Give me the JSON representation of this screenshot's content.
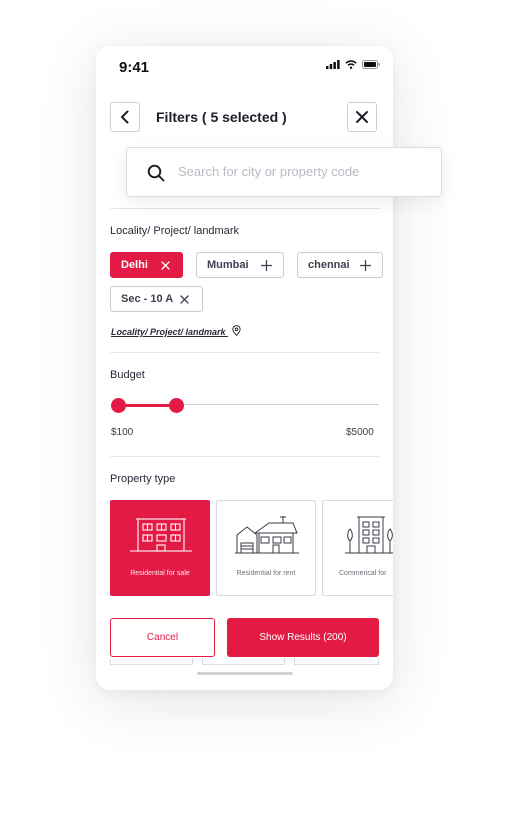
{
  "status_bar": {
    "time": "9:41"
  },
  "header": {
    "title": "Filters ( 5 selected )"
  },
  "search": {
    "placeholder": "Search for city or property code"
  },
  "locality": {
    "label": "Locality/ Project/ landmark",
    "chips": [
      {
        "label": "Delhi",
        "selected": true
      },
      {
        "label": "Mumbai",
        "selected": false
      },
      {
        "label": "chennai",
        "selected": false
      },
      {
        "label": "Sec - 10 A",
        "selected": true
      }
    ],
    "link_text": "Locality/ Project/ landmark"
  },
  "budget": {
    "label": "Budget",
    "min_label": "$100",
    "max_label": "$5000",
    "selected_range_fraction": [
      0.0,
      0.22
    ]
  },
  "property_type": {
    "label": "Property type",
    "options": [
      {
        "label": "Residential for sale",
        "selected": true,
        "icon": "apartment-building-icon"
      },
      {
        "label": "Residential for rent",
        "selected": false,
        "icon": "house-icon"
      },
      {
        "label": "Commerical for",
        "selected": false,
        "icon": "commercial-building-icon"
      }
    ]
  },
  "actions": {
    "cancel_label": "Cancel",
    "show_results_label": "Show Results (200)"
  },
  "colors": {
    "accent": "#e31b44",
    "text": "#1d1d2b",
    "border": "#d9dbe1"
  }
}
